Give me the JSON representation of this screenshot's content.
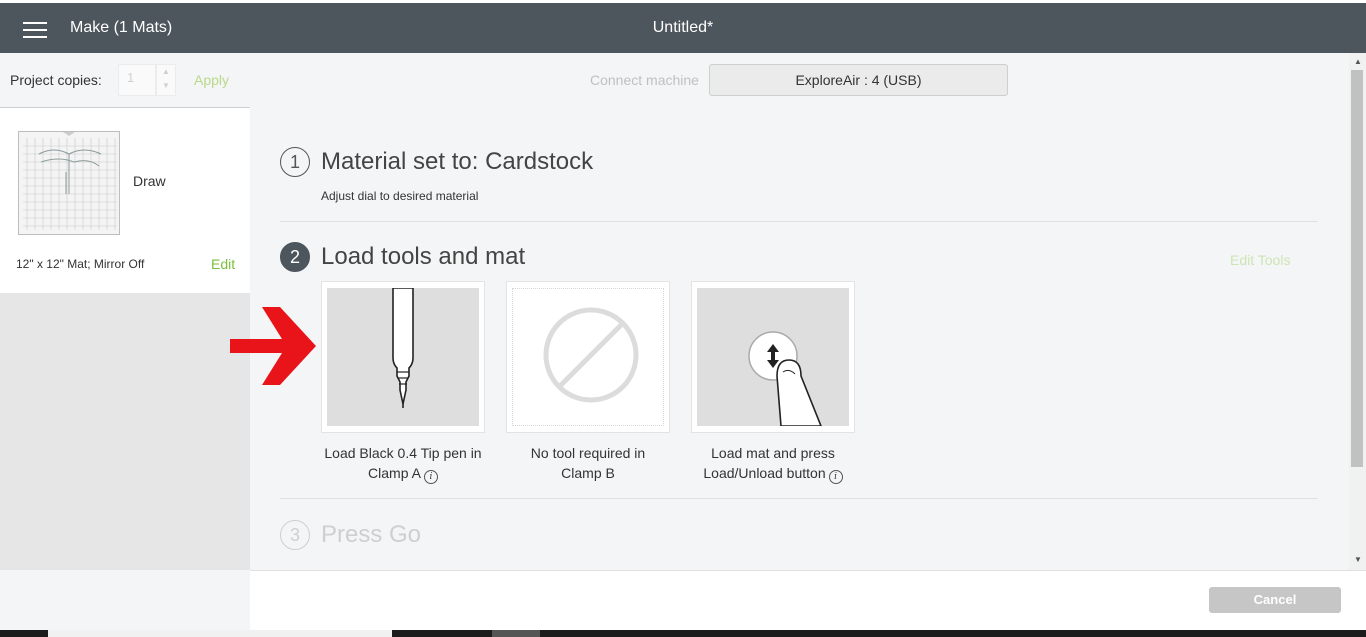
{
  "header": {
    "title": "Make (1 Mats)",
    "doc_title": "Untitled*"
  },
  "sidebar": {
    "project_copies_label": "Project copies:",
    "copies_value": "1",
    "apply_label": "Apply",
    "mat": {
      "label": "Draw",
      "info": "12\" x 12\" Mat; Mirror Off",
      "edit_label": "Edit"
    }
  },
  "main": {
    "connect_label": "Connect machine",
    "machine": "ExploreAir : 4 (USB)",
    "steps": [
      {
        "number": "1",
        "title": "Material set to: Cardstock",
        "subtitle": "Adjust dial to desired material"
      },
      {
        "number": "2",
        "title": "Load tools and mat",
        "edit_tools_label": "Edit Tools"
      },
      {
        "number": "3",
        "title": "Press Go"
      }
    ],
    "tiles": [
      {
        "caption_line1": "Load Black 0.4 Tip pen in",
        "caption_line2": "Clamp A"
      },
      {
        "caption_line1": "No tool required in",
        "caption_line2": "Clamp B"
      },
      {
        "caption_line1": "Load mat and press",
        "caption_line2": "Load/Unload button"
      }
    ]
  },
  "footer": {
    "cancel_label": "Cancel"
  },
  "colors": {
    "header": "#4d555d",
    "accent_green": "#7cbf3a",
    "arrow_red": "#e8141a"
  }
}
